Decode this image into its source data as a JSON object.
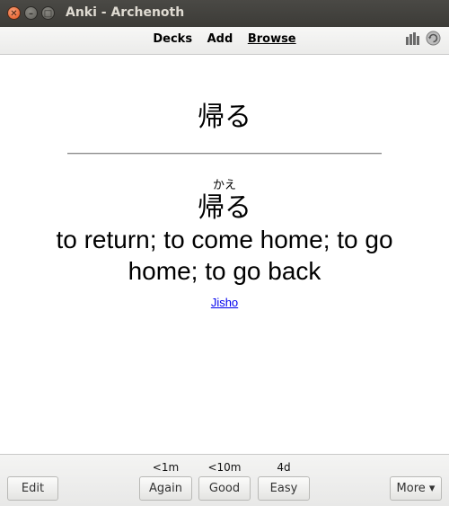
{
  "window": {
    "title": "Anki - Archenoth"
  },
  "toolbar": {
    "links": [
      "Decks",
      "Add",
      "Browse"
    ],
    "active": "Browse",
    "icons": [
      "stats-icon",
      "sync-icon"
    ]
  },
  "card": {
    "front": "帰る",
    "reading": "かえ",
    "kanji": "帰る",
    "meaning": "to return; to come home; to go home; to go back",
    "link": "Jisho"
  },
  "bottom": {
    "edit_label": "Edit",
    "more_label": "More ▾",
    "answers": [
      {
        "label": "Again",
        "due": "<1m"
      },
      {
        "label": "Good",
        "due": "<10m"
      },
      {
        "label": "Easy",
        "due": "4d"
      }
    ]
  }
}
